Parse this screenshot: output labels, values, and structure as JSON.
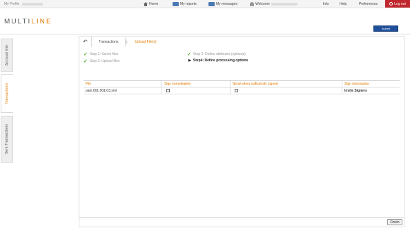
{
  "topbar": {
    "profile_label": "My Profile",
    "home": "Home",
    "reports": "My reports",
    "messages": "My messages",
    "welcome": "Welcome",
    "info": "Info",
    "help": "Help",
    "preferences": "Preferences",
    "logout": "Log out"
  },
  "brand": {
    "logo_main": "MULTI",
    "logo_accent": "LINE",
    "accent_color": "#e07a00",
    "header_button": "Submit"
  },
  "sidebar": {
    "tabs": [
      {
        "label": "Account Info",
        "active": false
      },
      {
        "label": "Transactions",
        "active": true
      },
      {
        "label": "Sent Transactions",
        "active": false
      }
    ]
  },
  "breadcrumb": {
    "items": [
      "Transactions",
      "Upload File(s)"
    ]
  },
  "steps": {
    "step1": "Step 1: Select files",
    "step2": "Step 2: Define attributes (optional)",
    "step3": "Step 3: Upload files",
    "step4": "Step4: Define processing options"
  },
  "table": {
    "headers": [
      "File",
      "Sign immediately",
      "Send when sufficiently signed",
      "Sign information"
    ],
    "rows": [
      {
        "file": "pain.001.001.03.xml",
        "sign_immediately": false,
        "send_when_signed": false,
        "sign_info": "Invite Signers"
      }
    ]
  },
  "footer": {
    "finish": "Finish"
  }
}
